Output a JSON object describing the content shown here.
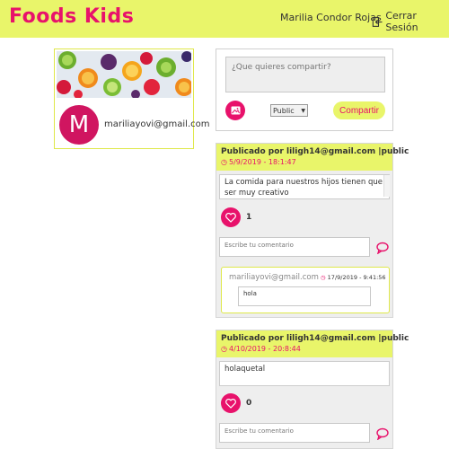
{
  "header": {
    "logo": "Foods Kids",
    "user_name": "Marilia Condor Rojas",
    "logout_label": "Cerrar Sesión"
  },
  "profile": {
    "avatar_letter": "M",
    "email": "mariliayovi@gmail.com"
  },
  "compose": {
    "placeholder": "¿Que quieres compartir?",
    "privacy_value": "Public",
    "share_label": "Compartir"
  },
  "posts": [
    {
      "author": "Publicado por liligh14@gmail.com",
      "privacy": "|public",
      "date": "5/9/2019 - 18:1:47",
      "text": "La comida para nuestros hijos tienen que ser muy creativo",
      "likes": "1",
      "comment_placeholder": "Escribe tu comentario",
      "comments": [
        {
          "author": "mariliayovi@gmail.com",
          "date": "17/9/2019 - 9:41:56",
          "text": "hola"
        }
      ]
    },
    {
      "author": "Publicado por liligh14@gmail.com",
      "privacy": "|public",
      "date": "4/10/2019 - 20:8:44",
      "text": "holaquetal",
      "likes": "0",
      "comment_placeholder": "Escribe tu comentario",
      "comments": []
    }
  ],
  "colors": {
    "accent_yellow": "#e9f56a",
    "accent_pink": "#e8126b"
  }
}
